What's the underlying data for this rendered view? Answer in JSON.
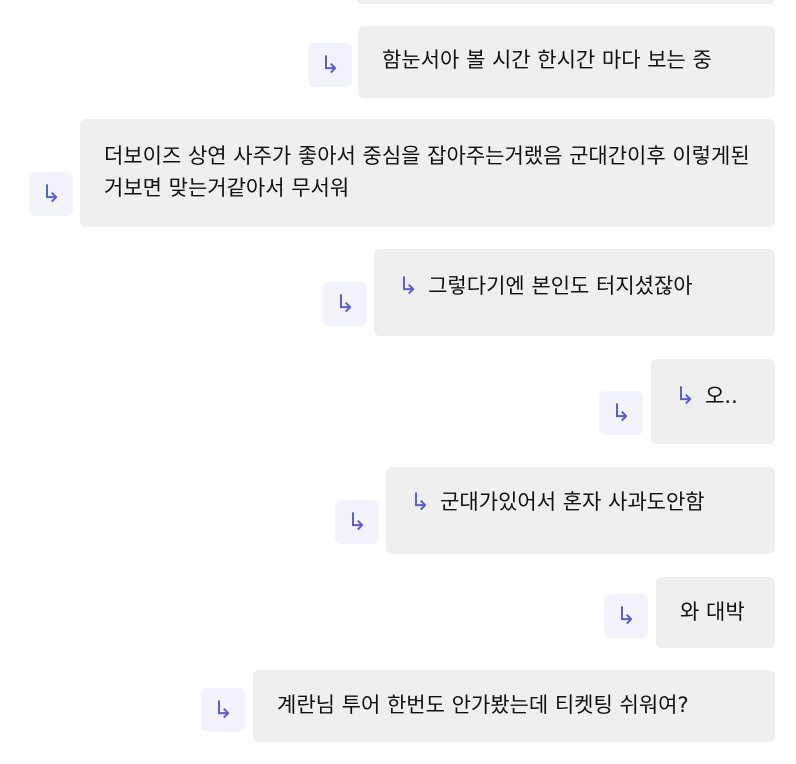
{
  "icons": {
    "reply_glyph": "↳",
    "accent_color": "#5b5fc7",
    "bubble_color": "#efefef",
    "button_bg": "#f3f3fb"
  },
  "messages": [
    {
      "text": "함눈서아 볼 시간 한시간 마다 보는 중"
    },
    {
      "text": "더보이즈 상연 사주가 좋아서 중심을 잡아주는거랬음 군대간이후 이렇게된거보면 맞는거같아서 무서워"
    },
    {
      "text": "그렇다기엔 본인도 터지셨잖아"
    },
    {
      "text": "오.."
    },
    {
      "text": "군대가있어서 혼자 사과도안함"
    },
    {
      "text": "와 대박"
    },
    {
      "text": "계란님 투어 한번도 안가봤는데 티켓팅 쉬워여?"
    }
  ]
}
